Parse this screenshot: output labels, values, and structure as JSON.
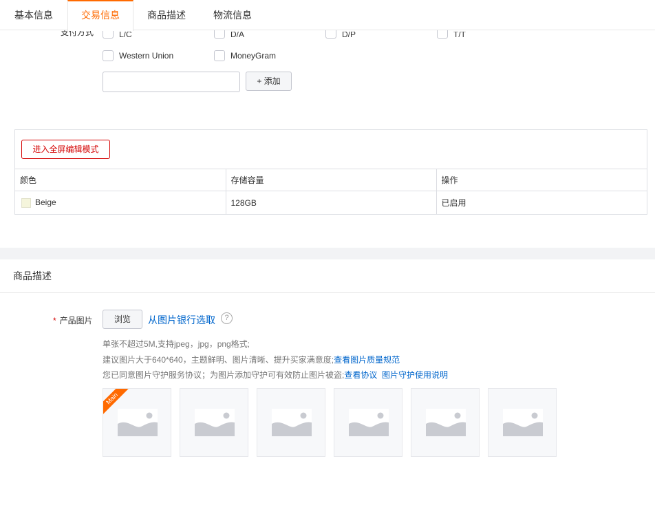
{
  "tabs": [
    {
      "label": "基本信息",
      "active": false
    },
    {
      "label": "交易信息",
      "active": true
    },
    {
      "label": "商品描述",
      "active": false
    },
    {
      "label": "物流信息",
      "active": false
    }
  ],
  "payment": {
    "label": "支付方式",
    "options": [
      "L/C",
      "D/A",
      "D/P",
      "T/T",
      "Western Union",
      "MoneyGram"
    ],
    "add_input_value": "",
    "add_button": "+ 添加"
  },
  "sku": {
    "fullscreen_button": "进入全屏编辑模式",
    "columns": [
      "颜色",
      "存储容量",
      "操作"
    ],
    "rows": [
      {
        "color": "Beige",
        "color_hex": "#f5f5dc",
        "storage": "128GB",
        "status": "已启用"
      }
    ]
  },
  "description": {
    "section_title": "商品描述",
    "field_label": "产品图片",
    "required_mark": "*",
    "browse_button": "浏览",
    "bank_link": "从图片银行选取",
    "help_icon": "question-circle-icon",
    "hint_line1": "单张不超过5M,支持jpeg，jpg，png格式;",
    "hint_line2": "建议图片大于640*640，主题鲜明、图片清晰、提升买家满意度;",
    "hint_line2_link": "查看图片质量规范",
    "hint_line3": "您已同意图片守护服务协议；为图片添加守护可有效防止图片被盗;",
    "hint_line3_link1": "查看协议",
    "hint_line3_link2": "图片守护使用说明",
    "main_badge": "Main",
    "thumb_icon": "image-placeholder-icon",
    "thumb_count": 6
  },
  "colors": {
    "accent": "#ff6a00",
    "danger": "#d40000",
    "link": "#0066cc"
  }
}
